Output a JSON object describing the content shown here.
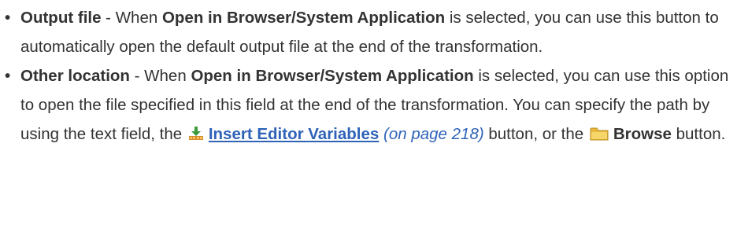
{
  "items": [
    {
      "bullet": "•",
      "term": "Output file",
      "sep1": " - When ",
      "option": "Open in Browser/System Application",
      "text": " is selected, you can use this button to automatically open the default output file at the end of the transformation."
    },
    {
      "bullet": "•",
      "term": "Other location",
      "sep1": " - When ",
      "option": "Open in Browser/System Application",
      "text1": " is selected, you can use this option to open the file specified in this field at the end of the transformation. You can specify the path by using the text field, the ",
      "insert_icon": "insert-editor-variables-icon",
      "insert_label": "Insert Editor Variables",
      "page_ref": "(on page 218)",
      "text2": " button, or the ",
      "browse_icon": "folder-icon",
      "browse_label": "Browse",
      "text3": " button."
    }
  ],
  "colors": {
    "text": "#333333",
    "link": "#2f63b8"
  }
}
